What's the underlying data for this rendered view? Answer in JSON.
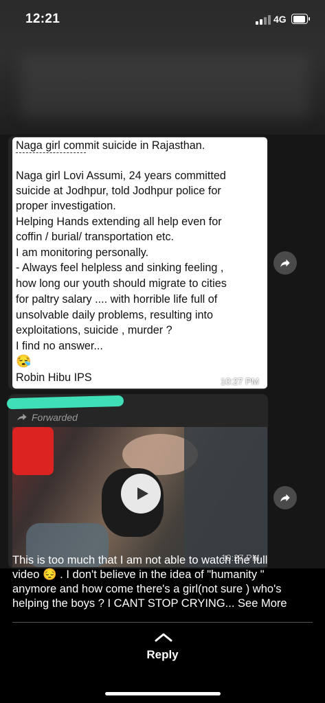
{
  "status_bar": {
    "time": "12:21",
    "network": "4G"
  },
  "message1": {
    "title": "Naga girl commit suicide in Rajasthan.",
    "lines": [
      "Naga girl Lovi Assumi, 24 years  committed",
      "suicide at Jodhpur, told Jodhpur police for",
      "proper investigation.",
      "Helping Hands extending all help even for",
      "coffin / burial/ transportation etc.",
      "I am monitoring personally.",
      "- Always feel helpless and sinking feeling ,",
      "how long our youth should migrate to cities",
      "for paltry salary .... with horrible life full of",
      "unsolvable daily problems,  resulting into",
      "exploitations,  suicide , murder ?",
      "I find no answer..."
    ],
    "emoji": "😪",
    "signature": "Robin Hibu IPS",
    "time": "10:27 PM"
  },
  "message2": {
    "forwarded_label": "Forwarded",
    "time": "10:27 PM"
  },
  "caption": {
    "line1": "This is too much that I am not able to watch the full",
    "line2_text": "video",
    "line2_emoji": "😔",
    "line2_rest": " . I don't believe in the idea of \"humanity \"",
    "line3": "anymore and how come there's a girl(not sure ) who's",
    "line4": "helping the boys ?   I CANT STOP CRYING...",
    "see_more": "See More"
  },
  "reply": {
    "label": "Reply"
  },
  "icons": {
    "forward": "share-arrow-icon",
    "play": "play-icon",
    "reply_chevron": "chevron-up-icon"
  }
}
